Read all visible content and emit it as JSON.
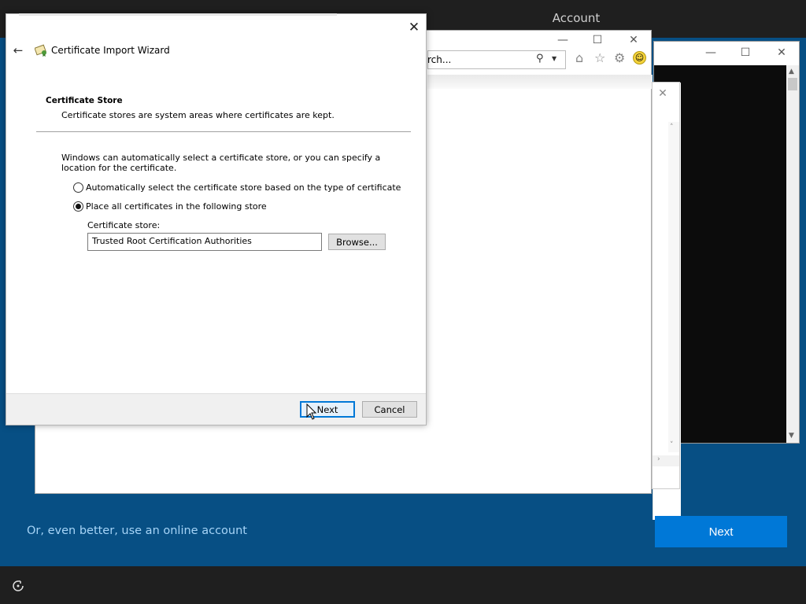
{
  "oobe": {
    "title": "Account",
    "online_link": "Or, even better, use an online account",
    "next_label": "Next",
    "accent": "#0078d7",
    "background": "#074f84"
  },
  "browser": {
    "search_placeholder": "rch...",
    "toolbar_icons": [
      "search-icon",
      "chevron-down-icon",
      "home-icon",
      "star-icon",
      "gear-icon",
      "smiley-icon"
    ]
  },
  "wizard": {
    "title": "Certificate Import Wizard",
    "section_title": "Certificate Store",
    "section_desc": "Certificate stores are system areas where certificates are kept.",
    "intro": "Windows can automatically select a certificate store, or you can specify a location for the certificate.",
    "option_auto": "Automatically select the certificate store based on the type of certificate",
    "option_place": "Place all certificates in the following store",
    "selected_option": "option_place",
    "store_label": "Certificate store:",
    "store_value": "Trusted Root Certification Authorities",
    "browse_label": "Browse...",
    "next_label": "Next",
    "cancel_label": "Cancel"
  }
}
